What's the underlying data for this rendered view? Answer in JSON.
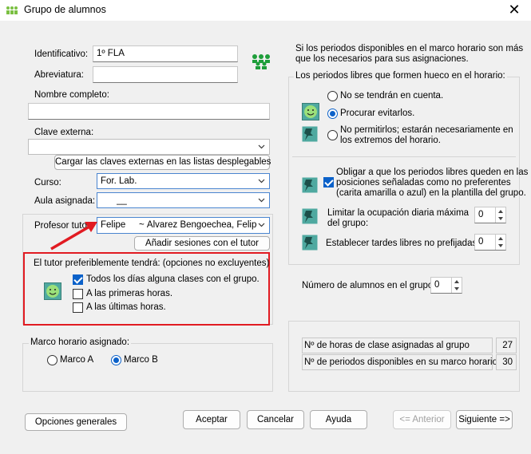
{
  "window": {
    "title": "Grupo de alumnos",
    "close_glyph": "✕"
  },
  "form": {
    "identificativo_label": "Identificativo:",
    "identificativo_value": "1º FLA",
    "abreviatura_label": "Abreviatura:",
    "abreviatura_value": "",
    "nombre_label": "Nombre completo:",
    "nombre_value": "",
    "clave_label": "Clave externa:",
    "clave_value": "",
    "cargar_button": "Cargar las claves externas en las listas desplegables",
    "curso_label": "Curso:",
    "curso_value": "For. Lab.",
    "aula_label": "Aula asignada:",
    "aula_value": "__",
    "profesor_label": "Profesor tutor:",
    "profesor_value_short": "Felipe",
    "profesor_value_full": "~ Álvarez Bengoechea, Felipe",
    "anadir_button": "Añadir sesiones con el tutor"
  },
  "tutor_pref": {
    "heading": "El tutor preferiblemente tendrá: (opciones no excluyentes)",
    "options": [
      {
        "label": "Todos los días alguna clases con el grupo.",
        "checked": true
      },
      {
        "label": "A las primeras horas.",
        "checked": false
      },
      {
        "label": "A las últimas horas.",
        "checked": false
      }
    ]
  },
  "marco": {
    "legend": "Marco horario asignado:",
    "options": [
      {
        "label": "Marco A",
        "selected": false
      },
      {
        "label": "Marco B",
        "selected": true
      }
    ]
  },
  "right": {
    "info_line1": "Si los periodos disponibles en el marco horario son más",
    "info_line2": "que los necesarios para sus asignaciones.",
    "libres_legend": "Los periodos libres que formen hueco en el horario:",
    "libres_options": [
      {
        "label": "No se tendrán en cuenta.",
        "selected": false
      },
      {
        "label": "Procurar evitarlos.",
        "selected": true
      },
      {
        "label_line1": "No permitirlos; estarán necesariamente en",
        "label_line2": "los extremos del horario.",
        "selected": false
      }
    ],
    "obligar_line1": "Obligar a que los periodos libres queden en las",
    "obligar_line2": "posiciones señaladas como no preferentes",
    "obligar_line3": "(carita amarilla o azul) en la plantilla del grupo.",
    "obligar_checked": true,
    "limitar_line1": "Limitar la ocupación diaria máxima",
    "limitar_line2": "del grupo:",
    "limitar_value": "0",
    "tardes_label": "Establecer tardes libres no prefijadas:",
    "tardes_value": "0",
    "num_alumnos_label": "Número de alumnos en el grupo:",
    "num_alumnos_value": "0",
    "stats": [
      {
        "label": "Nº de horas de clase asignadas al grupo",
        "value": "27"
      },
      {
        "label": "Nº de periodos disponibles en su marco horario",
        "value": "30"
      }
    ]
  },
  "footer": {
    "opciones": "Opciones generales",
    "aceptar": "Aceptar",
    "cancelar": "Cancelar",
    "ayuda": "Ayuda",
    "anterior": "<= Anterior",
    "siguiente": "Siguiente =>"
  },
  "colors": {
    "accent": "#0b61c9",
    "highlight_border": "#e11b22",
    "arrow": "#e11b22"
  }
}
